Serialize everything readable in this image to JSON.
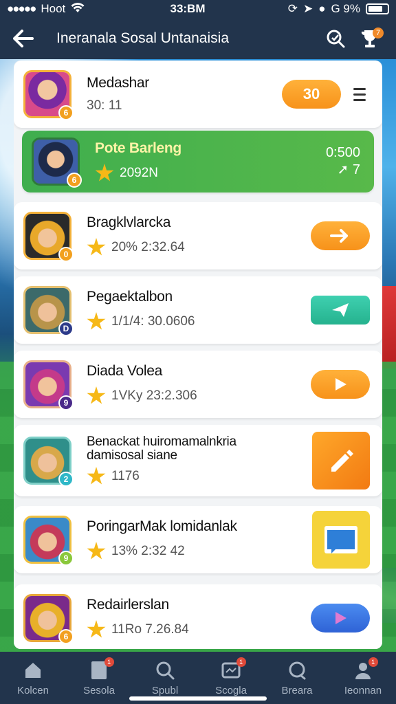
{
  "status_bar": {
    "carrier": "Hoot",
    "time": "33:BM",
    "battery": "G 9%"
  },
  "header": {
    "title": "Ineranala Sosal Untanaisia",
    "notification_count": "7"
  },
  "list": [
    {
      "name": "Medashar",
      "stat": "30: 11",
      "level": "6",
      "action_label": "30"
    },
    {
      "name": "Pote Barleng",
      "stat": "2092N",
      "level": "6",
      "right_top": "0:500",
      "right_bottom": "7"
    },
    {
      "name": "Bragklvlarcka",
      "stat": "20%  2:32.64",
      "level": "0"
    },
    {
      "name": "Pegaektalbon",
      "stat": "1/1/4:  30.0606",
      "level": "D"
    },
    {
      "name": "Diada Volea",
      "stat": "1VKy  23:2.306",
      "level": "9"
    },
    {
      "name": "Benackat huiromamalnkria",
      "name2": "damisosal siane",
      "stat": "1176",
      "level": "2"
    },
    {
      "name": "PoringarMak lomidanlak",
      "stat": "13%  2:32 42",
      "level": "9"
    },
    {
      "name": "Redairlerslan",
      "stat": "11Ro  7.26.84",
      "level": "6"
    }
  ],
  "tabs": [
    {
      "label": "Kolcen",
      "icon": "home-icon"
    },
    {
      "label": "Sesola",
      "icon": "document-icon",
      "badge": "1"
    },
    {
      "label": "Spubl",
      "icon": "search-icon"
    },
    {
      "label": "Scogla",
      "icon": "video-icon",
      "badge": "1"
    },
    {
      "label": "Breara",
      "icon": "chat-icon"
    },
    {
      "label": "Ieonnan",
      "icon": "profile-icon",
      "badge": "1"
    }
  ],
  "colors": {
    "nav_bg": "#22344c",
    "highlight_green": "#3fae4e",
    "accent_orange": "#f7921a",
    "star": "#f6b817"
  }
}
